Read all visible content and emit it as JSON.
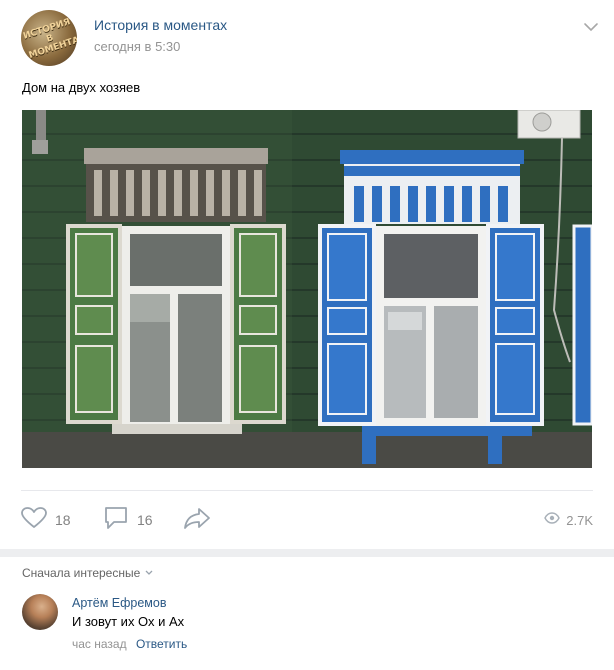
{
  "post": {
    "group_name": "История в моментах",
    "group_avatar_text": "ИСТОРИЯ В МОМЕНТАХ",
    "time": "сегодня в 5:30",
    "text": "Дом на двух хозяев",
    "image_icon": "photo-house-two-windows"
  },
  "actions": {
    "likes": "18",
    "comments": "16",
    "views": "2.7K",
    "like_icon": "heart-icon",
    "comment_icon": "comment-bubble-icon",
    "share_icon": "share-arrow-icon",
    "views_icon": "eye-icon"
  },
  "comments_section": {
    "sort_label": "Сначала интересные",
    "items": [
      {
        "author": "Артём Ефремов",
        "text": "И зовут их Ох и Ах",
        "time": "час назад",
        "reply_label": "Ответить"
      }
    ]
  },
  "colors": {
    "link": "#2a5885",
    "muted": "#939393",
    "divider": "#e7e8ec",
    "band": "#edeef0"
  }
}
